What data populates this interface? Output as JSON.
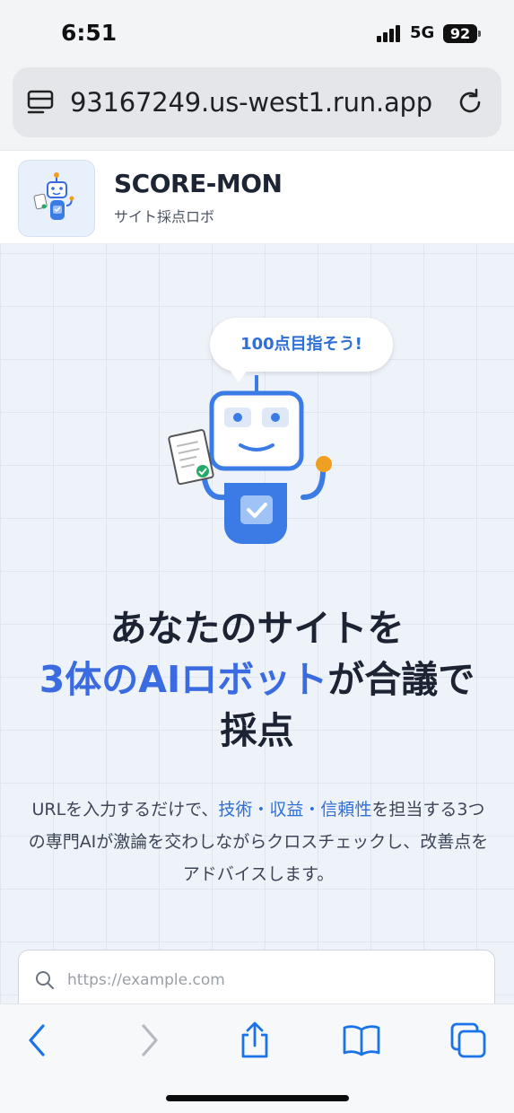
{
  "status_bar": {
    "time": "6:51",
    "network": "5G",
    "battery": "92"
  },
  "browser": {
    "url": "93167249.us-west1.run.app",
    "icons": {
      "tabs": "page-menu-icon",
      "reload": "reload-icon"
    }
  },
  "site_header": {
    "brand": "SCORE-MON",
    "subtitle": "サイト採点ロボ",
    "logo_icon": "robot-logo-icon"
  },
  "hero": {
    "bubble_text": "100点目指そう!",
    "headline_line1": "あなたのサイトを",
    "headline_accent": "3体のAIロボット",
    "headline_line2_rest": "が合議で",
    "headline_line3": "採点",
    "desc_part1": "URLを入力するだけで、",
    "desc_accent": "技術・収益・信頼性",
    "desc_part2": "を担当する3つの専門AIが激論を交わしながらクロスチェックし、改善点をアドバイスします。"
  },
  "search": {
    "placeholder": "https://example.com",
    "value": ""
  },
  "toolbar": {
    "buttons": [
      "back-icon",
      "forward-icon",
      "share-icon",
      "bookmarks-icon",
      "tabs-icon"
    ]
  },
  "colors": {
    "accent": "#3a6be0",
    "accent_text": "#2f6fd6",
    "dark_text": "#1c2333",
    "ios_blue": "#1a73e8"
  }
}
